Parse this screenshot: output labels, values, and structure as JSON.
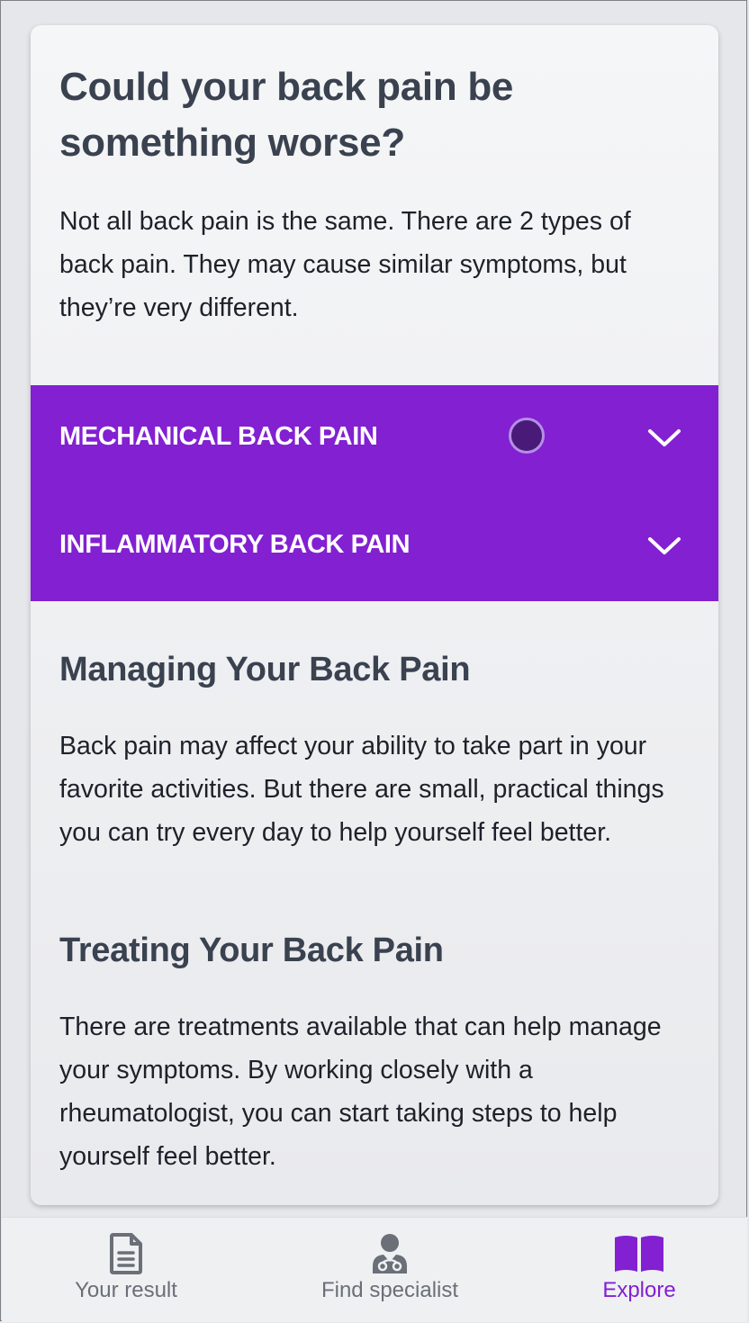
{
  "intro": {
    "title": "Could your back pain be something worse?",
    "body": "Not all back pain is the same. There are 2 types of back pain. They may cause similar symptoms, but they’re very different."
  },
  "accordion": {
    "items": [
      {
        "label": "MECHANICAL BACK PAIN",
        "icon": "chevron-down-icon"
      },
      {
        "label": "INFLAMMATORY BACK PAIN",
        "icon": "chevron-down-icon"
      }
    ]
  },
  "sections": {
    "managing": {
      "title": "Managing Your Back Pain",
      "body": "Back pain may affect your ability to take part in your favorite activities. But there are small, practical things you can try every day to help yourself feel better."
    },
    "treating": {
      "title": "Treating Your Back Pain",
      "body": "There are treatments available that can help manage your symptoms. By working closely with a rheumatologist, you can start taking steps to help yourself feel better."
    }
  },
  "bottom_nav": {
    "items": [
      {
        "label": "Your result",
        "icon": "document-icon",
        "active": false
      },
      {
        "label": "Find specialist",
        "icon": "doctor-icon",
        "active": false
      },
      {
        "label": "Explore",
        "icon": "open-book-icon",
        "active": true
      }
    ]
  },
  "colors": {
    "accent": "#8220d2",
    "heading": "#3a4250",
    "body_text": "#1d2129",
    "nav_inactive": "#6a6f78"
  }
}
